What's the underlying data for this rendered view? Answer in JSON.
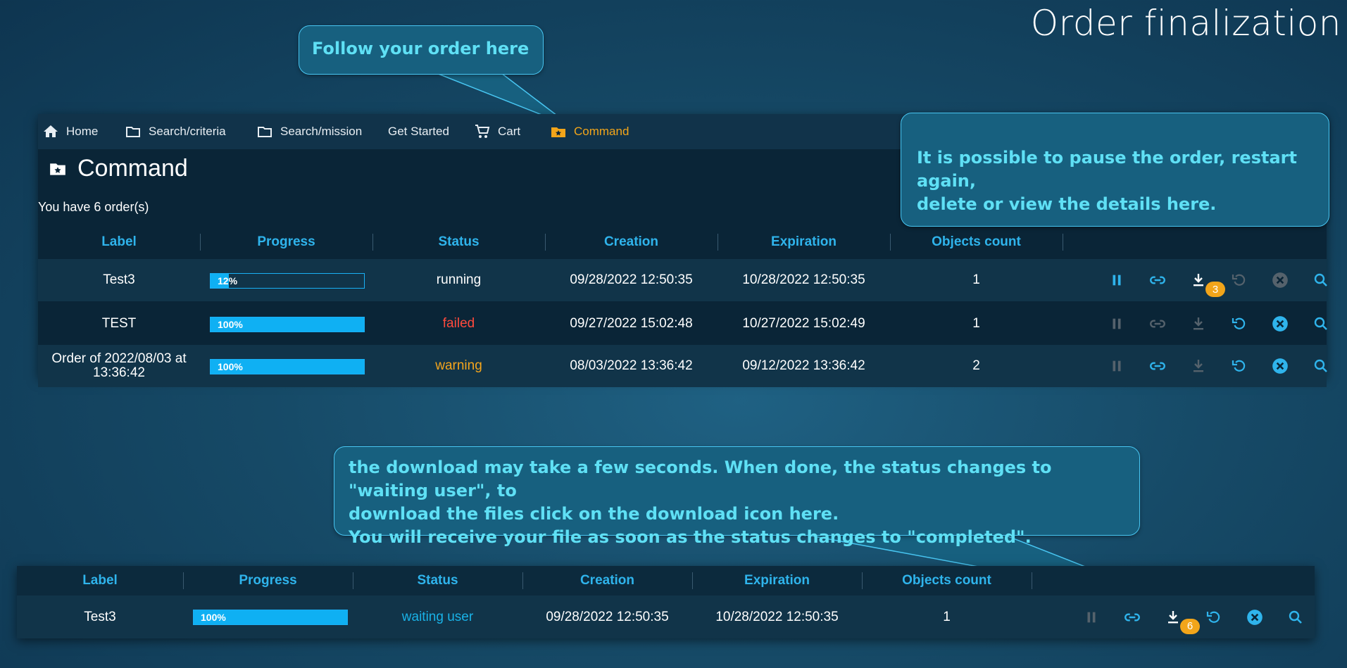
{
  "slide_title": "Order finalization",
  "callouts": {
    "follow": "Follow your order here",
    "pause": [
      "It is possible to pause the order, restart again,",
      "delete or view the details here."
    ],
    "download": [
      "the download may take a few seconds. When done, the status changes to \"waiting user\", to",
      "download the files click on the download icon here.",
      "You will receive your file as soon as the status changes to \"completed\"."
    ]
  },
  "nav": [
    {
      "label": "Home",
      "icon": "home-icon"
    },
    {
      "label": "Search/criteria",
      "icon": "folder-icon"
    },
    {
      "label": "Search/mission",
      "icon": "folder-icon"
    },
    {
      "label": "Get Started",
      "icon": ""
    },
    {
      "label": "Cart",
      "icon": "cart-icon"
    },
    {
      "label": "Command",
      "icon": "starred-folder-icon",
      "active": true
    }
  ],
  "page_title": "Command",
  "order_count": "You have 6 order(s)",
  "columns": [
    "Label",
    "Progress",
    "Status",
    "Creation",
    "Expiration",
    "Objects count"
  ],
  "rows": [
    {
      "label": "Test3",
      "progress": 12,
      "progress_text": "12%",
      "status": "running",
      "creation": "09/28/2022 12:50:35",
      "expiration": "10/28/2022 12:50:35",
      "objects": "1",
      "badge": "3"
    },
    {
      "label": "TEST",
      "progress": 100,
      "progress_text": "100%",
      "status": "failed",
      "creation": "09/27/2022 15:02:48",
      "expiration": "10/27/2022 15:02:49",
      "objects": "1",
      "badge": ""
    },
    {
      "label": "Order of 2022/08/03 at 13:36:42",
      "progress": 100,
      "progress_text": "100%",
      "status": "warning",
      "creation": "08/03/2022 13:36:42",
      "expiration": "09/12/2022 13:36:42",
      "objects": "2",
      "badge": ""
    }
  ],
  "detail_row": {
    "label": "Test3",
    "progress": 100,
    "progress_text": "100%",
    "status": "waiting user",
    "creation": "09/28/2022 12:50:35",
    "expiration": "10/28/2022 12:50:35",
    "objects": "1",
    "badge": "6"
  },
  "colors": {
    "accent": "#2fb4ec",
    "active_nav": "#f2a51a",
    "failed": "#ff4a3d",
    "warning": "#f4a51c",
    "callout_text": "#5fe0f5"
  }
}
